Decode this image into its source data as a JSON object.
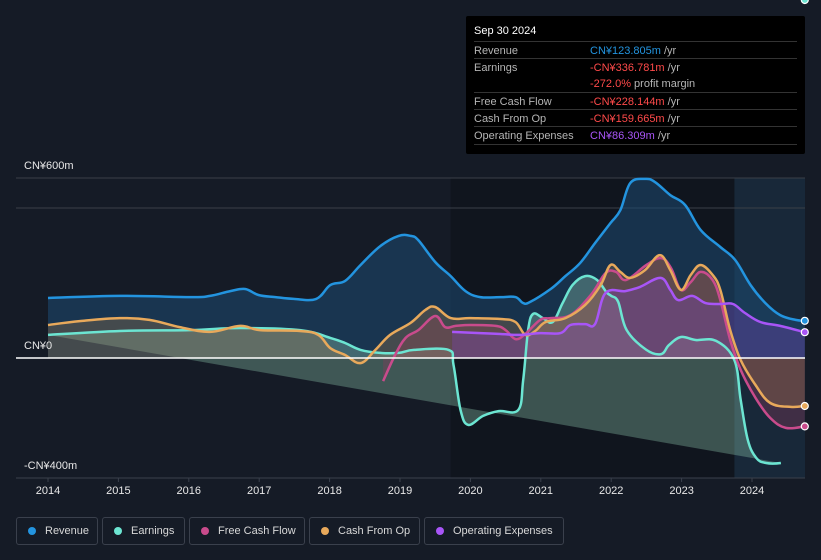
{
  "tooltip": {
    "date": "Sep 30 2024",
    "rows": [
      {
        "label": "Revenue",
        "value": "CN¥123.805m",
        "unit": " /yr",
        "color": "#2394df"
      },
      {
        "label": "Earnings",
        "value": "-CN¥336.781m",
        "unit": " /yr",
        "color": "#ff4a4a"
      },
      {
        "label": "",
        "value": "-272.0%",
        "unit": " profit margin",
        "color": "#ff4a4a"
      },
      {
        "label": "Free Cash Flow",
        "value": "-CN¥228.144m",
        "unit": " /yr",
        "color": "#ff4a4a"
      },
      {
        "label": "Cash From Op",
        "value": "-CN¥159.665m",
        "unit": " /yr",
        "color": "#ff4a4a"
      },
      {
        "label": "Operating Expenses",
        "value": "CN¥86.309m",
        "unit": " /yr",
        "color": "#a855f7"
      }
    ]
  },
  "legend": [
    {
      "label": "Revenue",
      "color": "#2394df"
    },
    {
      "label": "Earnings",
      "color": "#6ce5d2"
    },
    {
      "label": "Free Cash Flow",
      "color": "#c94b8c"
    },
    {
      "label": "Cash From Op",
      "color": "#e8a95b"
    },
    {
      "label": "Operating Expenses",
      "color": "#a855f7"
    }
  ],
  "chart_data": {
    "type": "line",
    "title": "",
    "xlabel": "",
    "ylabel": "",
    "currency": "CNY",
    "unit": "millions",
    "ylim": [
      -400,
      600
    ],
    "xlim": [
      2013.55,
      2024.75
    ],
    "y_tick_labels": [
      {
        "value": 600,
        "label": "CN¥600m"
      },
      {
        "value": 0,
        "label": "CN¥0"
      },
      {
        "value": -400,
        "label": "-CN¥400m"
      }
    ],
    "gridlines": [
      600,
      500
    ],
    "x_tick_labels": [
      "2014",
      "2015",
      "2016",
      "2017",
      "2018",
      "2019",
      "2020",
      "2021",
      "2022",
      "2023",
      "2024"
    ],
    "x_ticks": [
      2014,
      2015,
      2016,
      2017,
      2018,
      2019,
      2020,
      2021,
      2022,
      2023,
      2024
    ],
    "highlight_past_year_from": 2023.75,
    "series": [
      {
        "name": "Revenue",
        "color": "#2394df",
        "x": [
          2014.0,
          2015.02,
          2016.02,
          2016.3,
          2016.59,
          2016.8,
          2016.99,
          2017.23,
          2017.49,
          2017.81,
          2018.01,
          2018.22,
          2018.44,
          2018.72,
          2018.98,
          2019.15,
          2019.26,
          2019.5,
          2019.72,
          2019.93,
          2020.14,
          2020.43,
          2020.64,
          2020.75,
          2020.85,
          2021.14,
          2021.35,
          2021.56,
          2021.77,
          2021.99,
          2022.13,
          2022.27,
          2022.48,
          2022.62,
          2022.84,
          2023.05,
          2023.27,
          2023.55,
          2023.76,
          2023.98,
          2024.19,
          2024.4,
          2024.62,
          2024.75
        ],
        "values": [
          200,
          207,
          203,
          207,
          223,
          230,
          210,
          203,
          197,
          197,
          243,
          257,
          310,
          373,
          407,
          407,
          393,
          320,
          273,
          223,
          203,
          203,
          203,
          183,
          187,
          230,
          273,
          317,
          383,
          450,
          493,
          583,
          597,
          587,
          543,
          510,
          427,
          370,
          327,
          243,
          183,
          143,
          127,
          124
        ]
      },
      {
        "name": "Earnings",
        "color": "#6ce5d2",
        "x": [
          2014.0,
          2015.02,
          2016.02,
          2016.73,
          2017.58,
          2018.01,
          2018.22,
          2018.44,
          2018.72,
          2018.98,
          2019.2,
          2019.69,
          2019.76,
          2019.86,
          2019.97,
          2020.18,
          2020.4,
          2020.68,
          2020.75,
          2020.82,
          2020.89,
          2021.03,
          2021.17,
          2021.31,
          2021.45,
          2021.63,
          2021.8,
          2021.93,
          2022.0,
          2022.1,
          2022.22,
          2022.5,
          2022.71,
          2022.82,
          2022.99,
          2023.2,
          2023.49,
          2023.75,
          2023.84,
          2023.94,
          2024.06,
          2024.2,
          2024.41,
          2024.62,
          2024.75
        ],
        "values": [
          77,
          90,
          93,
          100,
          93,
          67,
          50,
          27,
          17,
          17,
          27,
          27,
          -23,
          -173,
          -223,
          -193,
          -177,
          -173,
          -73,
          93,
          147,
          133,
          120,
          183,
          243,
          273,
          260,
          220,
          207,
          187,
          93,
          27,
          13,
          43,
          70,
          60,
          57,
          -7,
          -140,
          -273,
          -333,
          -350,
          -350,
          -337
        ]
      },
      {
        "name": "Free Cash Flow",
        "color": "#c94b8c",
        "x": [
          2018.76,
          2018.93,
          2019.08,
          2019.26,
          2019.5,
          2019.64,
          2019.79,
          2020.0,
          2020.36,
          2020.5,
          2020.64,
          2020.78,
          2020.99,
          2021.14,
          2021.42,
          2021.71,
          2021.92,
          2022.07,
          2022.21,
          2022.5,
          2022.71,
          2022.85,
          2022.99,
          2023.13,
          2023.27,
          2023.44,
          2023.55,
          2023.69,
          2023.84,
          2024.05,
          2024.26,
          2024.48,
          2024.75
        ],
        "values": [
          -77,
          10,
          67,
          93,
          140,
          103,
          107,
          110,
          107,
          93,
          63,
          80,
          127,
          133,
          143,
          210,
          283,
          287,
          260,
          310,
          333,
          300,
          227,
          253,
          287,
          260,
          193,
          60,
          -40,
          -133,
          -200,
          -233,
          -228
        ]
      },
      {
        "name": "Cash From Op",
        "color": "#e8a95b",
        "x": [
          2014.0,
          2014.45,
          2015.02,
          2015.44,
          2015.87,
          2016.3,
          2016.73,
          2017.01,
          2017.58,
          2017.84,
          2018.01,
          2018.22,
          2018.44,
          2018.65,
          2018.86,
          2019.15,
          2019.36,
          2019.5,
          2019.72,
          2020.0,
          2020.43,
          2020.64,
          2020.78,
          2020.92,
          2021.07,
          2021.35,
          2021.63,
          2021.85,
          2021.99,
          2022.13,
          2022.27,
          2022.48,
          2022.69,
          2022.84,
          2022.99,
          2023.13,
          2023.27,
          2023.44,
          2023.55,
          2023.69,
          2023.84,
          2024.05,
          2024.26,
          2024.55,
          2024.75
        ],
        "values": [
          110,
          123,
          133,
          127,
          103,
          87,
          107,
          93,
          90,
          77,
          33,
          10,
          -17,
          27,
          77,
          117,
          160,
          170,
          133,
          133,
          130,
          120,
          77,
          90,
          120,
          133,
          177,
          243,
          310,
          287,
          267,
          293,
          343,
          293,
          227,
          277,
          310,
          277,
          227,
          93,
          -7,
          -90,
          -150,
          -163,
          -160
        ]
      },
      {
        "name": "Operating Expenses",
        "color": "#a855f7",
        "x": [
          2019.74,
          2020.14,
          2020.43,
          2020.71,
          2020.99,
          2021.28,
          2021.42,
          2021.63,
          2021.77,
          2021.92,
          2022.2,
          2022.41,
          2022.7,
          2022.84,
          2022.95,
          2023.15,
          2023.34,
          2023.55,
          2023.73,
          2023.9,
          2024.12,
          2024.4,
          2024.75
        ],
        "values": [
          87,
          83,
          80,
          77,
          83,
          83,
          110,
          113,
          113,
          217,
          223,
          237,
          267,
          227,
          193,
          207,
          183,
          180,
          180,
          150,
          120,
          107,
          86
        ]
      }
    ]
  }
}
